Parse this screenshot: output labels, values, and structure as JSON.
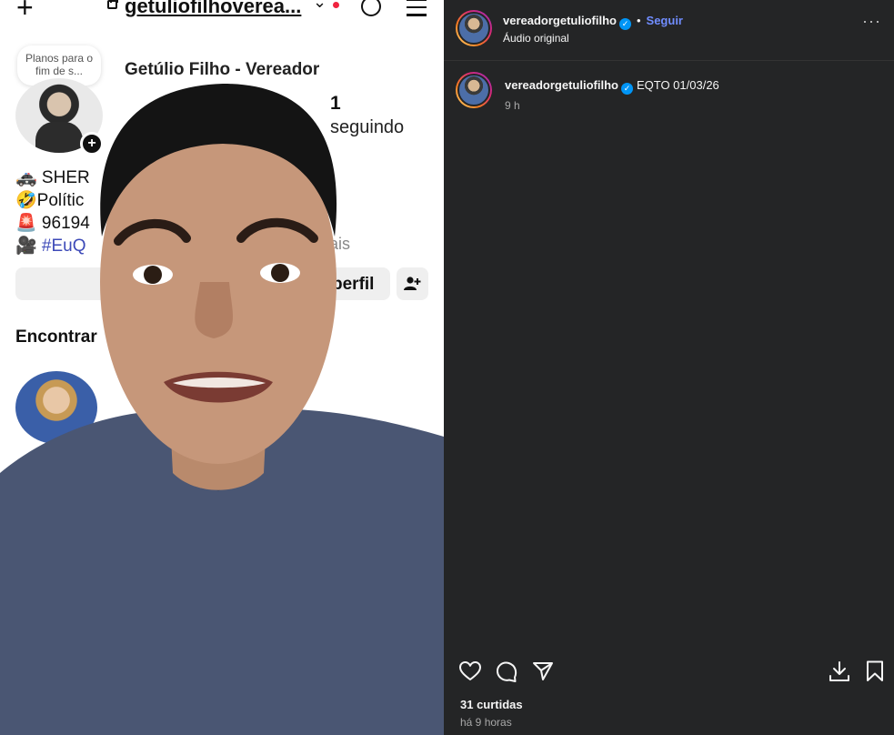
{
  "video": {
    "username": "getuliofilhoverea...",
    "note": "Planos para o fim de s...",
    "profile_name": "Getúlio Filho - Vereador",
    "following_count": "1",
    "following_label": "seguindo",
    "bio": [
      "🚓 SHER",
      "🤣Polític",
      "🚨 96194",
      "🎥 #EuQ"
    ],
    "bio_extra": "ais",
    "button_label": "perfil",
    "found_label": "Encontrar"
  },
  "post": {
    "author": "vereadorgetuliofilho",
    "separator": "•",
    "follow_label": "Seguir",
    "audio": "Áudio original",
    "more": "···",
    "comment": {
      "author": "vereadorgetuliofilho",
      "text": "EQTO 01/03/26",
      "time": "9 h"
    },
    "likes": "31 curtidas",
    "posted_ago": "há 9 horas"
  },
  "icons": [
    "heart-icon",
    "comment-icon",
    "share-icon",
    "download-icon",
    "bookmark-icon",
    "verified-icon",
    "more-icon",
    "threads-icon",
    "menu-icon",
    "lock-icon",
    "add-person-icon"
  ],
  "colors": {
    "panel_bg": "#242526",
    "link": "#708dff",
    "verified": "#0095f6"
  }
}
